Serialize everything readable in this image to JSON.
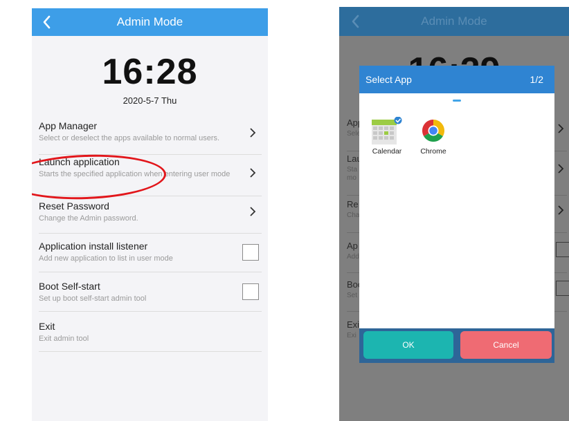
{
  "left": {
    "header": {
      "title": "Admin Mode"
    },
    "clock": {
      "time": "16:28",
      "date": "2020-5-7 Thu"
    },
    "menu": [
      {
        "title": "App Manager",
        "desc": "Select or deselect the apps available to normal users."
      },
      {
        "title": "Launch application",
        "desc": "Starts the specified application when entering user mode"
      },
      {
        "title": "Reset Password",
        "desc": "Change the Admin password."
      },
      {
        "title": "Application install listener",
        "desc": "Add new application to list in user mode"
      },
      {
        "title": "Boot Self-start",
        "desc": "Set up boot self-start admin tool"
      },
      {
        "title": "Exit",
        "desc": "Exit admin tool"
      }
    ],
    "accent_color": "#3d9ee8",
    "highlight_color": "#e2161b"
  },
  "right": {
    "background": {
      "title": "Admin Mode",
      "clock": "16:29",
      "rows": [
        {
          "t": "App",
          "d": "Sele"
        },
        {
          "t": "Lau",
          "d": "Sta",
          "d2": "mo"
        },
        {
          "t": "Re",
          "d": "Cha"
        },
        {
          "t": "Ap",
          "d": "Add"
        },
        {
          "t": "Boo",
          "d": "Set"
        },
        {
          "t": "Exi",
          "d": "Exi"
        }
      ]
    },
    "dialog": {
      "title": "Select App",
      "page": "1/2",
      "apps": [
        {
          "label": "Calendar",
          "icon": "calendar-icon",
          "selected": true
        },
        {
          "label": "Chrome",
          "icon": "chrome-icon",
          "selected": false
        }
      ],
      "ok_label": "OK",
      "cancel_label": "Cancel",
      "ok_color": "#1cb5b0",
      "cancel_color": "#ef6b73"
    }
  }
}
